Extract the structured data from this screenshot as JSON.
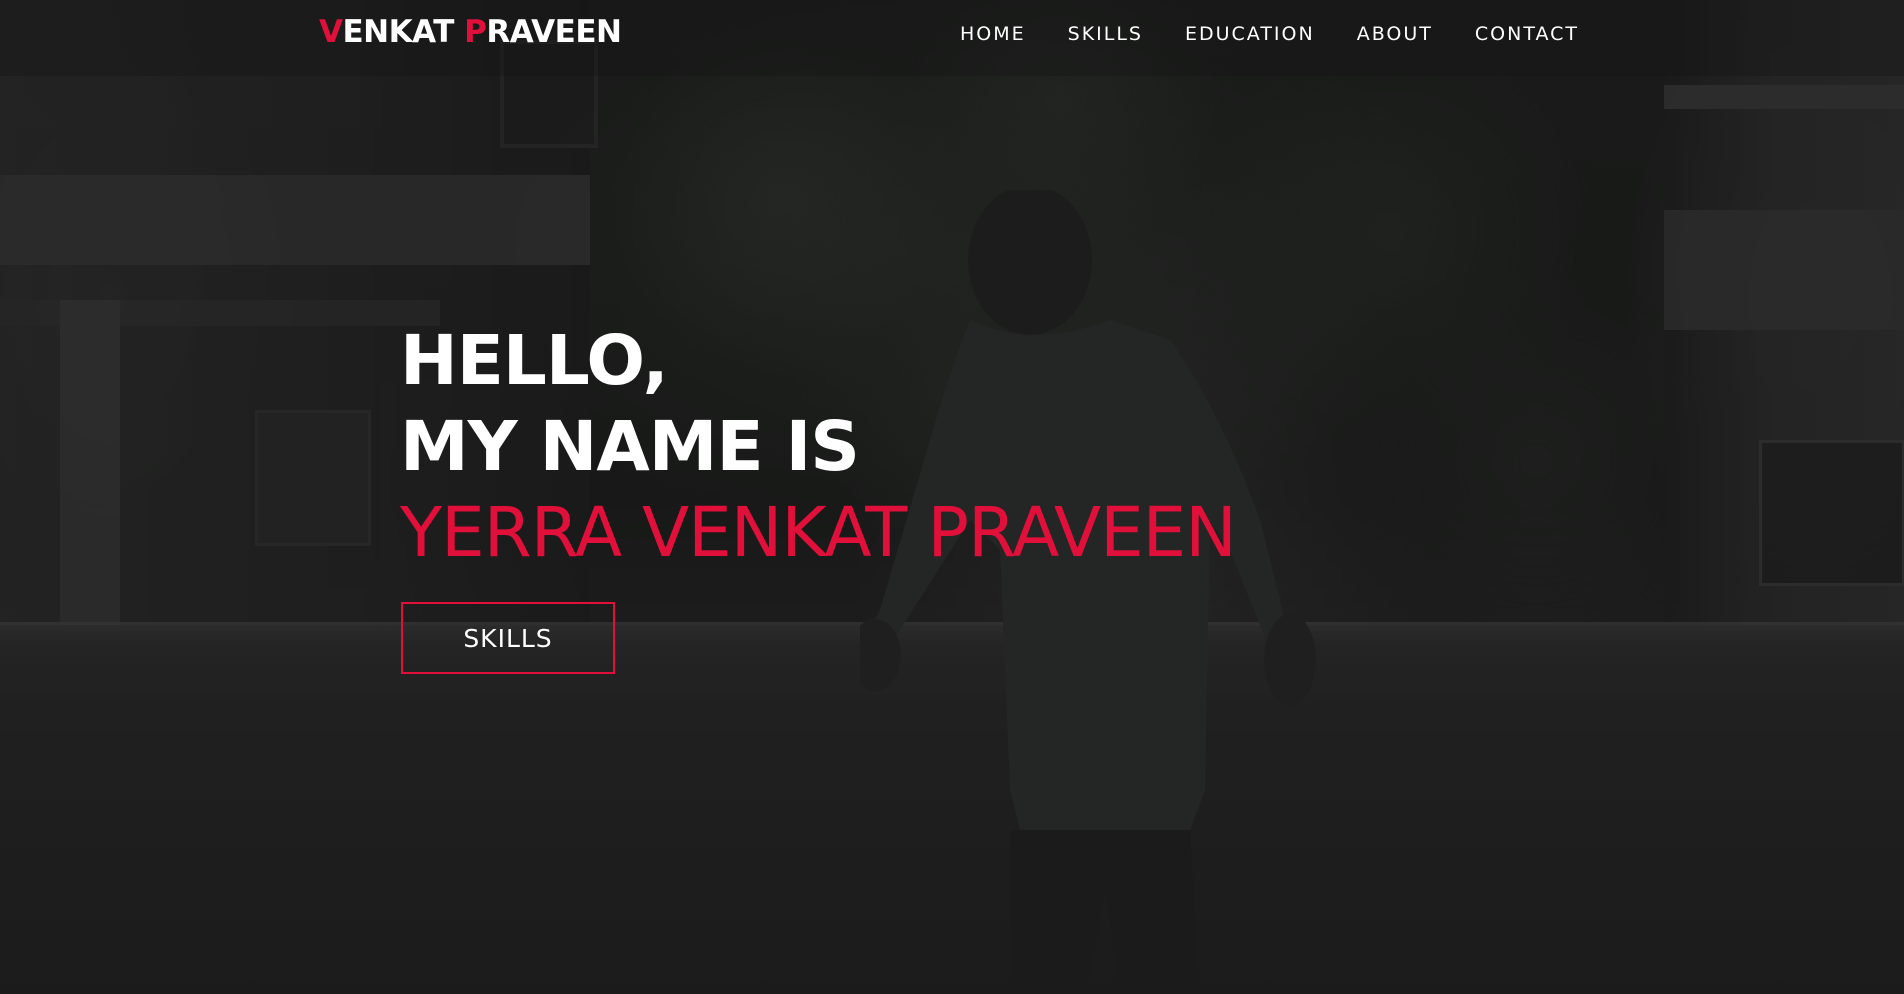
{
  "brand": {
    "first_initial": "V",
    "first_rest": "ENKAT",
    "second_initial": "P",
    "second_rest": "RAVEEN",
    "accent_color": "#e0103a"
  },
  "nav": {
    "items": [
      {
        "label": "HOME"
      },
      {
        "label": "SKILLS"
      },
      {
        "label": "EDUCATION"
      },
      {
        "label": "ABOUT"
      },
      {
        "label": "CONTACT"
      }
    ]
  },
  "hero": {
    "greeting": "HELLO,",
    "intro": "MY NAME IS",
    "name": "YERRA VENKAT PRAVEEN",
    "cta_label": "SKILLS"
  }
}
